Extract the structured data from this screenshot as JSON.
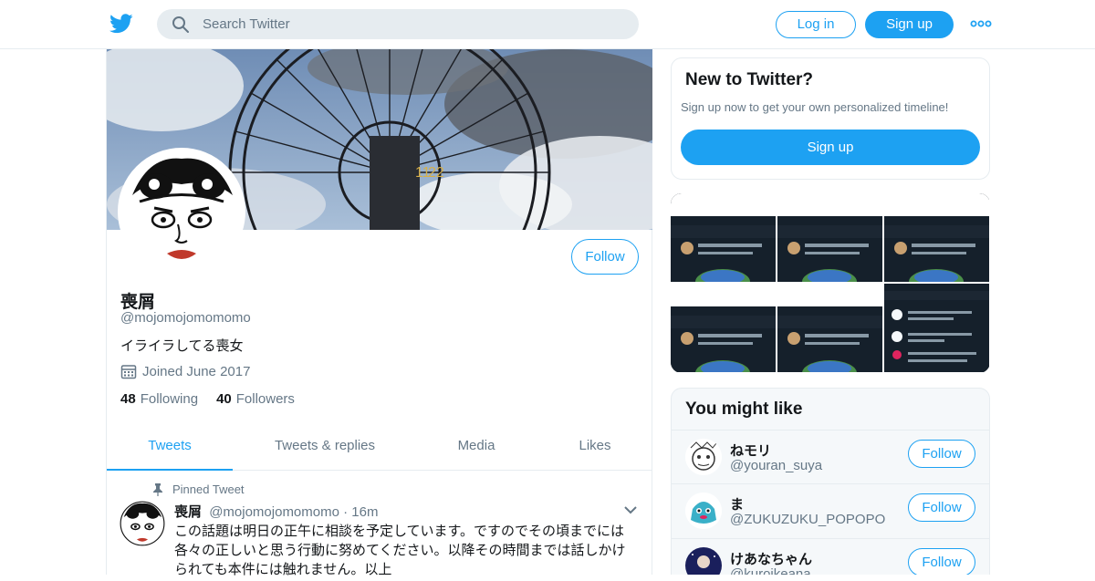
{
  "header": {
    "search_placeholder": "Search Twitter",
    "login_label": "Log in",
    "signup_label": "Sign up"
  },
  "profile": {
    "name": "喪屑",
    "handle": "@mojomojomomomo",
    "bio": "イライラしてる喪女",
    "joined": "Joined June 2017",
    "following_count": "48",
    "following_label": "Following",
    "followers_count": "40",
    "followers_label": "Followers",
    "follow_label": "Follow"
  },
  "tabs": [
    {
      "label": "Tweets",
      "active": true
    },
    {
      "label": "Tweets & replies",
      "active": false
    },
    {
      "label": "Media",
      "active": false
    },
    {
      "label": "Likes",
      "active": false
    }
  ],
  "pinned_tweet": {
    "pinned_label": "Pinned Tweet",
    "name": "喪屑",
    "handle": "@mojomojomomomo",
    "separator": "·",
    "time": "16m",
    "text": "この話題は明日の正午に相談を予定しています。ですのでその頃までには各々の正しいと思う行動に努めてください。以降その時間までは話しかけられても本件には触れません。以上"
  },
  "new_to_twitter": {
    "title": "New to Twitter?",
    "subtitle": "Sign up now to get your own personalized timeline!",
    "button": "Sign up"
  },
  "you_might_like": {
    "title": "You might like",
    "users": [
      {
        "name": "ねモリ",
        "handle": "@youran_suya",
        "follow": "Follow"
      },
      {
        "name": "ま",
        "handle": "@ZUKUZUKU_POPOPO",
        "follow": "Follow"
      },
      {
        "name": "けあなちゃん",
        "handle": "@kuroikeana",
        "follow": "Follow"
      }
    ]
  },
  "colors": {
    "accent": "#1da1f2",
    "muted": "#657786",
    "text": "#14171a",
    "border": "#e6ecf0"
  }
}
